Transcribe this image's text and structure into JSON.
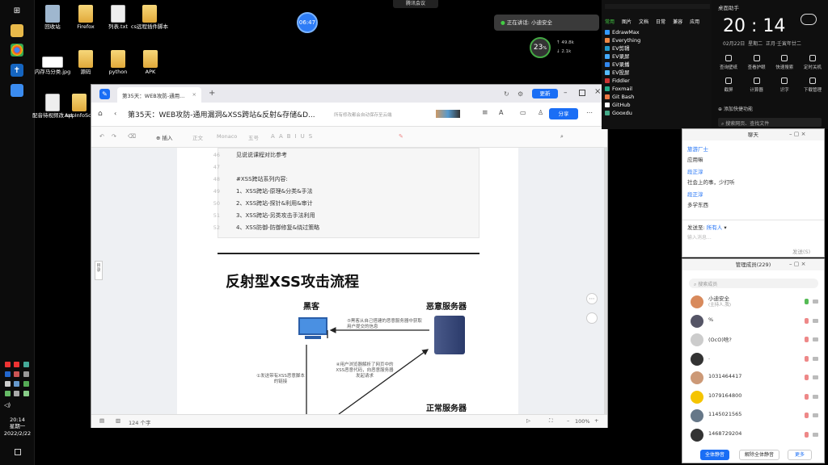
{
  "taskbar": {
    "tray_text": "2022/2/22",
    "time": "20:14",
    "weekday": "星期一",
    "date": "2022/2/22",
    "volume_glyph": "◁)"
  },
  "desktop": {
    "icons": [
      {
        "label": "回收站",
        "kind": "recycle"
      },
      {
        "label": "Firefox",
        "kind": "folder"
      },
      {
        "label": "列表.txt",
        "kind": "file"
      },
      {
        "label": "cs远程插件脚本",
        "kind": "folder"
      },
      {
        "label": "内存马分类.jpg",
        "kind": "image"
      },
      {
        "label": "源码",
        "kind": "folder"
      },
      {
        "label": "python",
        "kind": "folder"
      },
      {
        "label": "APK",
        "kind": "folder"
      },
      {
        "label": "配音待视频改.txt",
        "kind": "file"
      },
      {
        "label": "AppInfoScanner",
        "kind": "folder"
      }
    ]
  },
  "meeting": {
    "bar_title": "腾讯会议",
    "recording_timer": "06:47",
    "speaking_prefix": "正在讲话:",
    "speaker": "小迪安全",
    "cpu_value": "23",
    "cpu_unit": "%",
    "net_up": "49.8k",
    "net_down": "2.1k"
  },
  "doc": {
    "tab_title": "第35天：WEB攻防-通用...",
    "doc_title": "第35天：WEB攻防-通用漏洞&XSS跨站&反射&存储&D...",
    "save_status": "所有修改都会自动保存至云端",
    "update_button": "更新",
    "share_button": "分享",
    "toolbar": {
      "insert": "插入",
      "style": "正文",
      "font": "Monaco",
      "size": "五号"
    },
    "lines": [
      {
        "num": "46",
        "text": "见说说课程对比参考"
      },
      {
        "num": "47",
        "text": ""
      },
      {
        "num": "48",
        "text": "#XSS跨站系列内容:"
      },
      {
        "num": "49",
        "text": "1、XSS跨站-原理&分类&手法"
      },
      {
        "num": "50",
        "text": "2、XSS跨站-探针&利用&审计"
      },
      {
        "num": "51",
        "text": "3、XSS跨站-另类攻击手法利用"
      },
      {
        "num": "52",
        "text": "4、XSS防御-防御修复&绕过策略"
      }
    ],
    "side_tab": "目录",
    "diagram": {
      "title": "反射型XSS攻击流程",
      "hacker": "黑客",
      "evil_server": "恶意服务器",
      "normal_server": "正常服务器",
      "step5": "⑤黑客从自己搭建的恶意服务器中获取用户提交的信息",
      "step4": "④用户浏览器解析了网页中的XSS恶意代码，向恶意服务器发起请求",
      "step1": "①发送带有XSS恶意脚本的链接"
    },
    "status": {
      "word_count": "124 个字",
      "zoom": "100%"
    }
  },
  "apps_panel": {
    "tabs": [
      "常用",
      "图片",
      "文档",
      "日常",
      "兼容",
      "应用"
    ],
    "items": [
      "EdrawMax",
      "Everything",
      "EV剪辑",
      "EV录屏",
      "EV录播",
      "EV投屏",
      "Fiddler",
      "Foxmail",
      "Git Bash",
      "GitHub",
      "Gooxdu"
    ]
  },
  "clock_panel": {
    "header": "桌面助手",
    "time": "20 : 14",
    "date": "02月22日",
    "weekday": "星期二",
    "lunar": "正月·壬寅年廿二",
    "tools_row1": [
      "查询壁纸",
      "查看护眼",
      "快速搜索",
      "定时关机"
    ],
    "tools_row2": [
      "截屏",
      "计算器",
      "识字",
      "下载管理"
    ],
    "shortcut": "添加快捷功能",
    "search_placeholder": "搜索网页、查找文件"
  },
  "chat": {
    "title": "聊天",
    "messages": [
      {
        "sender": "旅游厂士",
        "text": "应用嘛"
      },
      {
        "sender": "段正淳",
        "text": "社会上的事，少打听"
      },
      {
        "sender": "段正淳",
        "text": "多学东西"
      }
    ],
    "send_to_label": "发送至:",
    "send_to_value": "所有人",
    "input_placeholder": "输入消息...",
    "send_button": "发送(S)"
  },
  "members": {
    "title": "管理成员(229)",
    "search_placeholder": "搜索成员",
    "list": [
      {
        "name": "小迪安全",
        "sub": "(主持人,我)",
        "color": "#d88a5c"
      },
      {
        "name": "%",
        "sub": "",
        "color": "#556"
      },
      {
        "name": "(OcO)啥?",
        "sub": "",
        "color": "#ccc"
      },
      {
        "name": ".",
        "sub": "",
        "color": "#333"
      },
      {
        "name": "1031464417",
        "sub": "",
        "color": "#c97"
      },
      {
        "name": "1079164800",
        "sub": "",
        "color": "#f5c400"
      },
      {
        "name": "1145021565",
        "sub": "",
        "color": "#678"
      },
      {
        "name": "1468729204",
        "sub": "",
        "color": "#333"
      }
    ],
    "mute_all": "全体静音",
    "unmute_all": "解除全体静音",
    "more": "更多"
  }
}
